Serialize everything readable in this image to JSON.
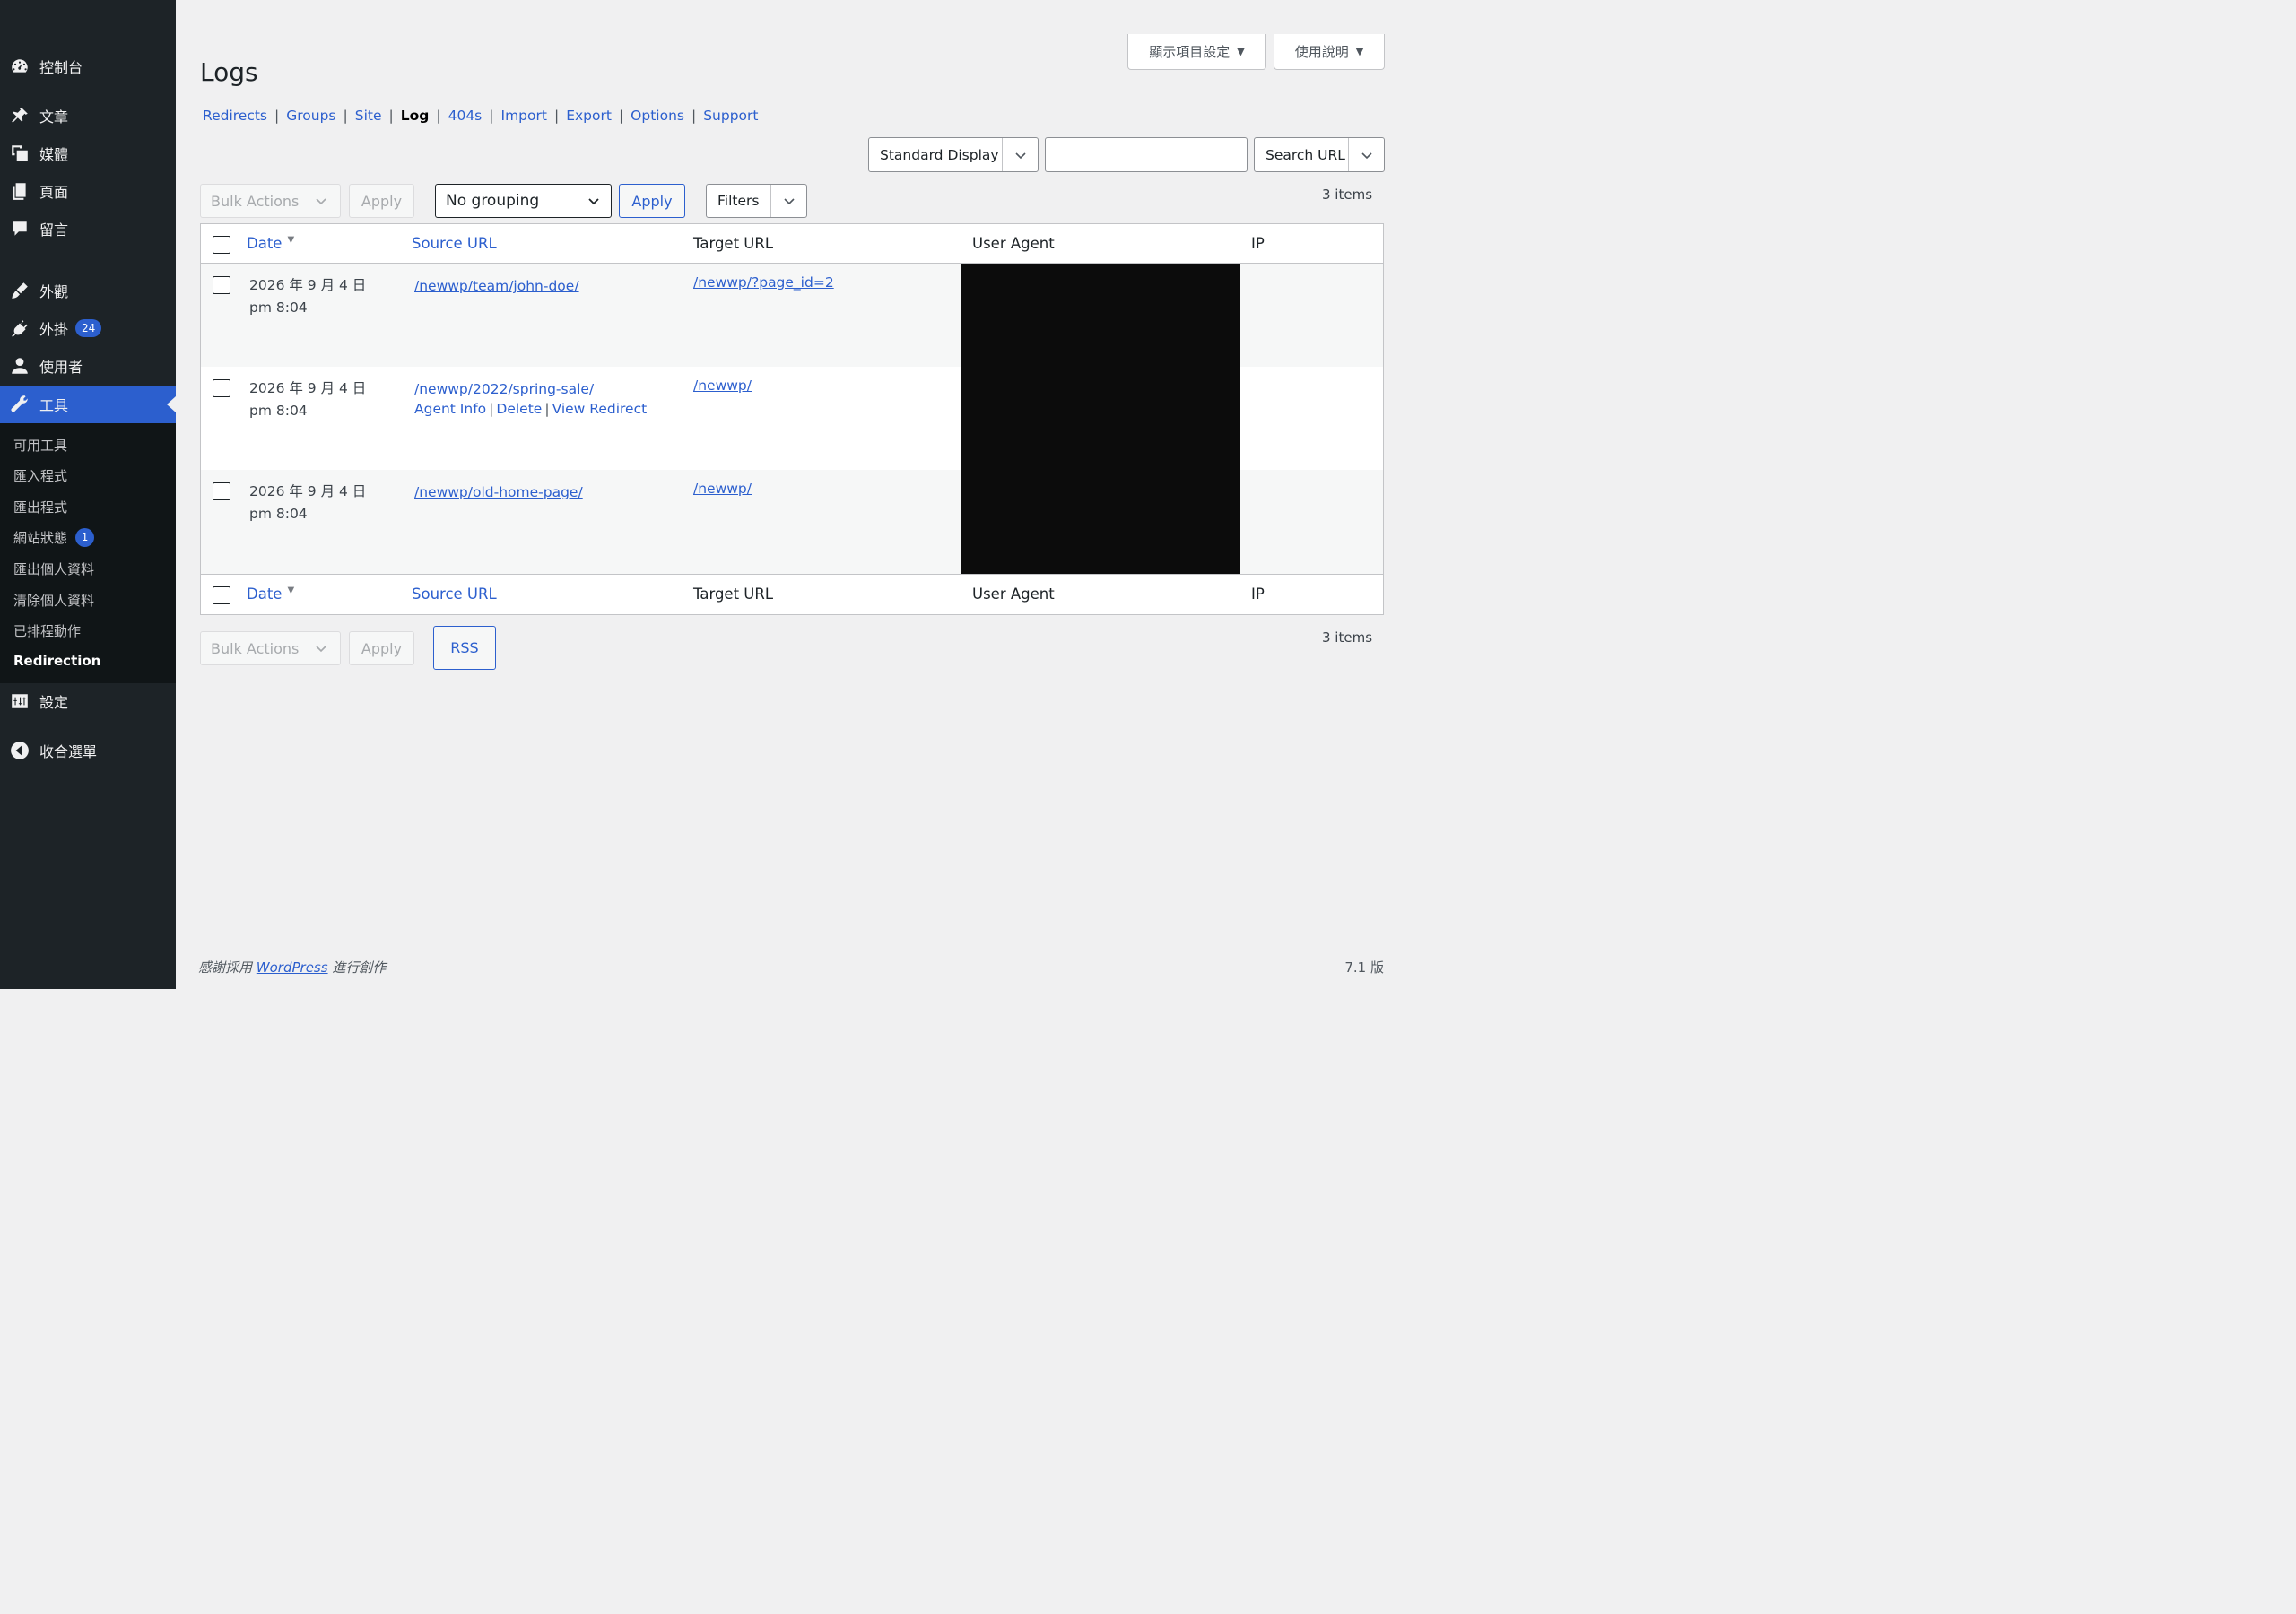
{
  "sidebar": {
    "items": [
      {
        "label": "控制台",
        "icon": "dashboard-icon"
      },
      {
        "label": "文章",
        "icon": "pin-icon"
      },
      {
        "label": "媒體",
        "icon": "media-icon"
      },
      {
        "label": "頁面",
        "icon": "pages-icon"
      },
      {
        "label": "留言",
        "icon": "comments-icon"
      },
      {
        "label": "外觀",
        "icon": "appearance-icon"
      },
      {
        "label": "外掛",
        "icon": "plugins-icon",
        "badge": "24"
      },
      {
        "label": "使用者",
        "icon": "users-icon"
      },
      {
        "label": "工具",
        "icon": "tools-icon"
      },
      {
        "label": "設定",
        "icon": "settings-icon"
      },
      {
        "label": "收合選單",
        "icon": "collapse-icon"
      }
    ],
    "submenu": [
      {
        "label": "可用工具"
      },
      {
        "label": "匯入程式"
      },
      {
        "label": "匯出程式"
      },
      {
        "label": "網站狀態",
        "badge": "1"
      },
      {
        "label": "匯出個人資料"
      },
      {
        "label": "清除個人資料"
      },
      {
        "label": "已排程動作"
      },
      {
        "label": "Redirection"
      }
    ]
  },
  "header": {
    "screen_options": "顯示項目設定",
    "help": "使用說明",
    "title": "Logs"
  },
  "nav": {
    "links": [
      "Redirects",
      "Groups",
      "Site",
      "Log",
      "404s",
      "Import",
      "Export",
      "Options",
      "Support"
    ],
    "current": "Log"
  },
  "search": {
    "display": "Standard Display",
    "value": "",
    "button": "Search URL"
  },
  "toolbar": {
    "bulk_actions": "Bulk Actions",
    "apply": "Apply",
    "grouping": "No grouping",
    "apply_group": "Apply",
    "filters": "Filters",
    "items": "3 items",
    "rss": "RSS"
  },
  "table": {
    "columns": [
      "Date",
      "Source URL",
      "Target URL",
      "User Agent",
      "IP"
    ],
    "rows": [
      {
        "date1": "2026 年 9 月 4 日",
        "date2": "pm 8:04",
        "source": "/newwp/team/john-doe/",
        "target": "/newwp/?page_id=2"
      },
      {
        "date1": "2026 年 9 月 4 日",
        "date2": "pm 8:04",
        "source": "/newwp/2022/spring-sale/",
        "target": "/newwp/",
        "actions": [
          "Agent Info",
          "Delete",
          "View Redirect"
        ]
      },
      {
        "date1": "2026 年 9 月 4 日",
        "date2": "pm 8:04",
        "source": "/newwp/old-home-page/",
        "target": "/newwp/"
      }
    ]
  },
  "footer": {
    "thanks_prefix": "感謝採用 ",
    "thanks_link": "WordPress",
    "thanks_suffix": " 進行創作",
    "version": "7.1 版"
  }
}
